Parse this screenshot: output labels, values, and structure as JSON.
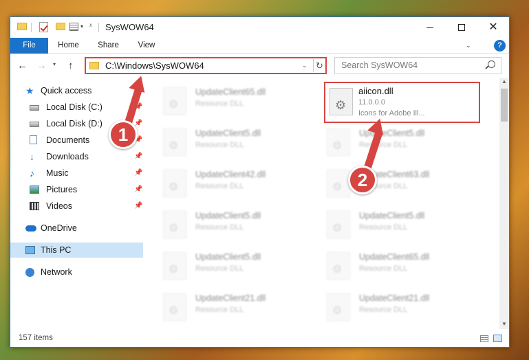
{
  "window": {
    "title": "SysWOW64"
  },
  "ribbon": {
    "tabs": [
      "File",
      "Home",
      "Share",
      "View"
    ],
    "help_label": "?"
  },
  "address_bar": {
    "path": "C:\\Windows\\SysWOW64",
    "refresh_label": "↻"
  },
  "search": {
    "placeholder": "Search SysWOW64"
  },
  "sidebar": {
    "items": [
      {
        "label": "Quick access",
        "icon": "star-icon"
      },
      {
        "label": "Local Disk (C:)",
        "icon": "drive-icon",
        "pinned": true
      },
      {
        "label": "Local Disk (D:)",
        "icon": "drive-icon",
        "pinned": true
      },
      {
        "label": "Documents",
        "icon": "documents-icon",
        "pinned": true
      },
      {
        "label": "Downloads",
        "icon": "downloads-icon",
        "pinned": true
      },
      {
        "label": "Music",
        "icon": "music-icon",
        "pinned": true
      },
      {
        "label": "Pictures",
        "icon": "pictures-icon",
        "pinned": true
      },
      {
        "label": "Videos",
        "icon": "videos-icon",
        "pinned": true
      },
      {
        "label": "OneDrive",
        "icon": "onedrive-icon"
      },
      {
        "label": "This PC",
        "icon": "this-pc-icon",
        "selected": true
      },
      {
        "label": "Network",
        "icon": "network-icon"
      }
    ]
  },
  "files": {
    "highlighted": {
      "name": "aiicon.dll",
      "version": "11.0.0.0",
      "description": "Icons for Adobe Ill..."
    },
    "left_column": [
      {
        "name": "UpdateClient65.dll",
        "type": "Resource DLL"
      },
      {
        "name": "UpdateClient5.dll",
        "type": "Resource DLL"
      },
      {
        "name": "UpdateClient42.dll",
        "type": "Resource DLL"
      },
      {
        "name": "UpdateClient5.dll",
        "type": "Resource DLL"
      },
      {
        "name": "UpdateClient5.dll",
        "type": "Resource DLL"
      },
      {
        "name": "UpdateClient21.dll",
        "type": "Resource DLL"
      }
    ],
    "right_column": [
      {
        "name": "UpdateClient5.dll",
        "type": "Resource DLL"
      },
      {
        "name": "UpdateClient63.dll",
        "type": "Resource DLL"
      },
      {
        "name": "UpdateClient5.dll",
        "type": "Resource DLL"
      },
      {
        "name": "UpdateClient65.dll",
        "type": "Resource DLL"
      },
      {
        "name": "UpdateClient21.dll",
        "type": "Resource DLL"
      }
    ]
  },
  "status": {
    "item_count": "157 items"
  },
  "annotations": {
    "badge_1": "1",
    "badge_2": "2",
    "color": "#d64542"
  },
  "colors": {
    "accent": "#1a73c8",
    "selection": "#cce4f7",
    "highlight_border": "#d64542"
  }
}
